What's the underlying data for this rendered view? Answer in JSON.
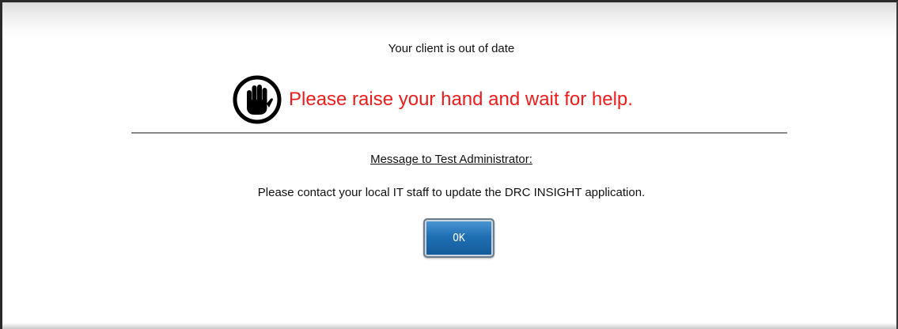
{
  "dialog": {
    "title": "Your client is out of date",
    "alert_icon": "raised-hand-icon",
    "alert_message": "Please raise your hand and wait for help.",
    "admin_heading": "Message to Test Administrator:",
    "admin_message": "Please contact your local IT staff to update the DRC INSIGHT application.",
    "ok_label": "OK"
  },
  "colors": {
    "alert_text": "#f01b1b",
    "button_blue": "#1f6fb4",
    "divider": "#8a8a8a"
  }
}
